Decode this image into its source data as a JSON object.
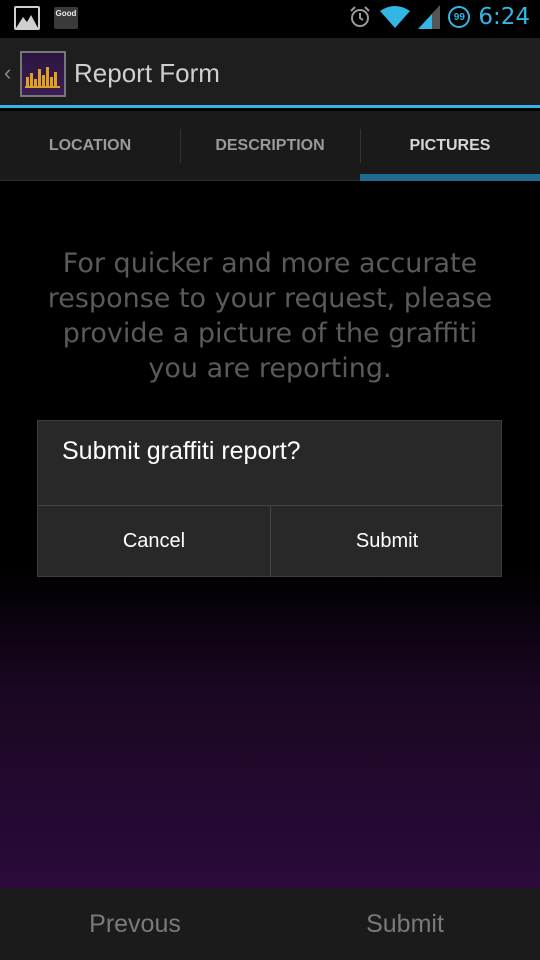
{
  "status_bar": {
    "notification_icons": [
      "image-icon",
      "good-icon"
    ],
    "good_label": "Good",
    "battery_badge": "99",
    "time": "6:24"
  },
  "action_bar": {
    "title": "Report Form"
  },
  "tabs": [
    {
      "label": "LOCATION",
      "active": false
    },
    {
      "label": "DESCRIPTION",
      "active": false
    },
    {
      "label": "PICTURES",
      "active": true
    }
  ],
  "content": {
    "instructions": "For quicker and more accurate response to your request, please provide a picture of the graffiti you are reporting."
  },
  "dialog": {
    "title": "Submit graffiti report?",
    "cancel_label": "Cancel",
    "submit_label": "Submit"
  },
  "bottom_bar": {
    "previous_label": "Prevous",
    "submit_label": "Submit"
  },
  "colors": {
    "accent": "#33b5e5",
    "tab_indicator": "#1f6b8f",
    "dialog_bg": "#282828"
  }
}
